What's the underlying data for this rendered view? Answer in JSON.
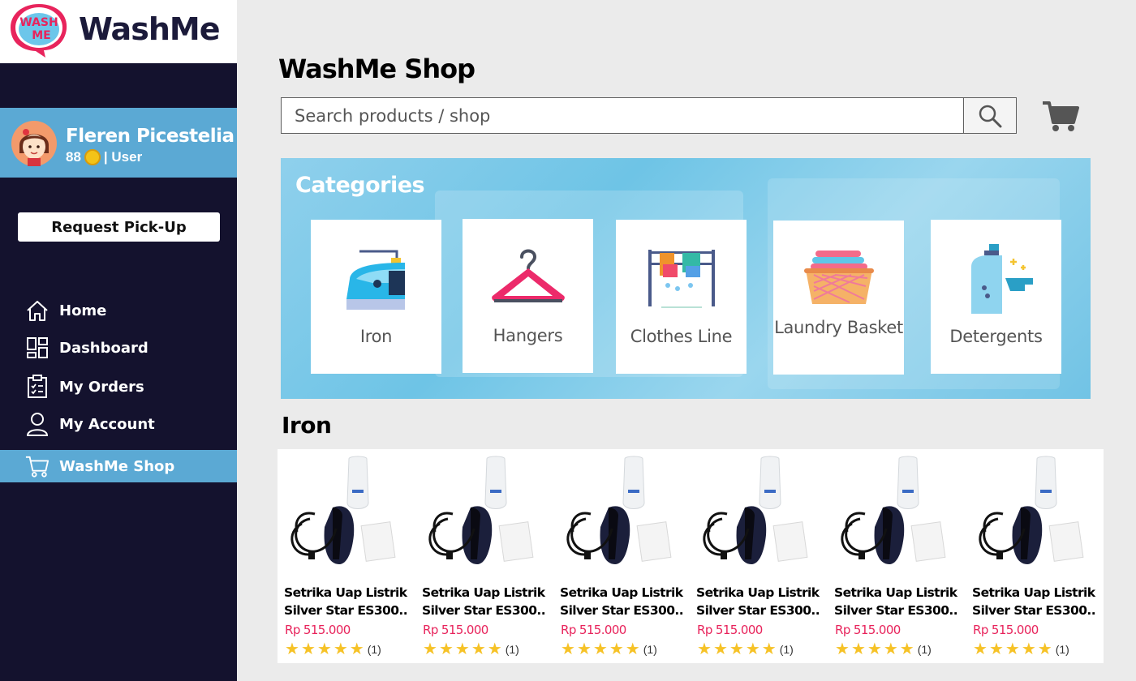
{
  "app": {
    "name": "WashMe",
    "logo_text": "WASH ME"
  },
  "user": {
    "name": "Fleren Picestelia",
    "coins": "88",
    "role": "| User"
  },
  "sidebar": {
    "pickup_label": "Request Pick-Up",
    "items": [
      {
        "label": "Home",
        "icon": "home-icon"
      },
      {
        "label": "Dashboard",
        "icon": "dashboard-icon"
      },
      {
        "label": "My Orders",
        "icon": "clipboard-icon"
      },
      {
        "label": "My Account",
        "icon": "user-icon"
      },
      {
        "label": "WashMe Shop",
        "icon": "cart-icon",
        "active": true
      }
    ]
  },
  "main": {
    "title": "WashMe Shop",
    "search_placeholder": "Search products / shop",
    "categories_title": "Categories",
    "categories": [
      {
        "label": "Iron",
        "icon": "iron-icon"
      },
      {
        "label": "Hangers",
        "icon": "hanger-icon"
      },
      {
        "label": "Clothes Line",
        "icon": "clothesline-icon"
      },
      {
        "label": "Laundry Basket",
        "icon": "laundry-basket-icon"
      },
      {
        "label": "Detergents",
        "icon": "detergent-icon"
      }
    ],
    "section_title": "Iron",
    "products": [
      {
        "name_line1": "Setrika Uap Listrik",
        "name_line2": "Silver Star ES300..",
        "price": "Rp 515.000",
        "rating": 5,
        "reviews": "(1)"
      },
      {
        "name_line1": "Setrika Uap Listrik",
        "name_line2": "Silver Star ES300..",
        "price": "Rp 515.000",
        "rating": 5,
        "reviews": "(1)"
      },
      {
        "name_line1": "Setrika Uap Listrik",
        "name_line2": "Silver Star ES300..",
        "price": "Rp 515.000",
        "rating": 5,
        "reviews": "(1)"
      },
      {
        "name_line1": "Setrika Uap Listrik",
        "name_line2": "Silver Star ES300..",
        "price": "Rp 515.000",
        "rating": 5,
        "reviews": "(1)"
      },
      {
        "name_line1": "Setrika Uap Listrik",
        "name_line2": "Silver Star ES300..",
        "price": "Rp 515.000",
        "rating": 5,
        "reviews": "(1)"
      },
      {
        "name_line1": "Setrika Uap Listrik",
        "name_line2": "Silver Star ES300..",
        "price": "Rp 515.000",
        "rating": 5,
        "reviews": "(1)"
      }
    ]
  },
  "colors": {
    "sidebar_bg": "#14122e",
    "accent": "#5ba9d4",
    "price": "#e8245c",
    "star": "#f6c226",
    "brand_pink": "#e8245c"
  }
}
